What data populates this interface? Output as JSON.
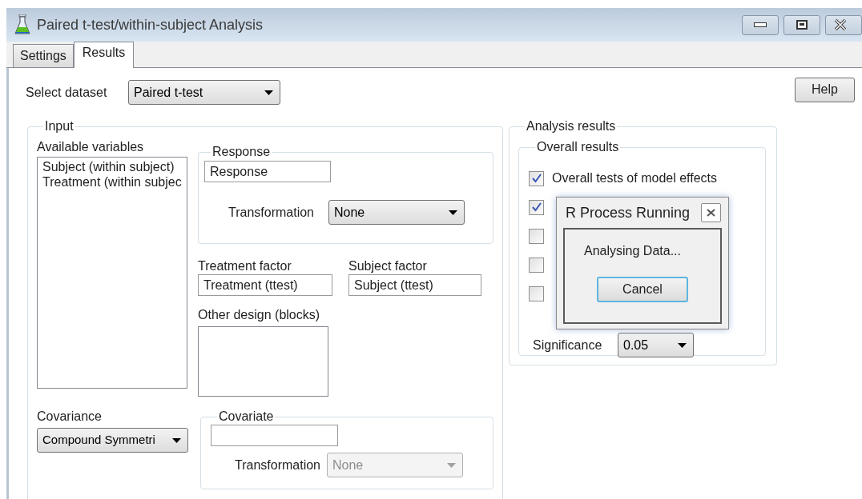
{
  "window": {
    "title": "Paired t-test/within-subject Analysis"
  },
  "tabs": [
    {
      "label": "Settings",
      "selected": false
    },
    {
      "label": "Results",
      "selected": true
    }
  ],
  "dataset": {
    "label": "Select dataset",
    "value": "Paired t-test"
  },
  "help_button": "Help",
  "input": {
    "title": "Input",
    "available_variables": {
      "label": "Available variables",
      "items": [
        "Subject (within subject)",
        "Treatment (within subjec"
      ]
    },
    "response": {
      "title": "Response",
      "value": "Response",
      "transformation": {
        "label": "Transformation",
        "value": "None",
        "disabled": false
      }
    },
    "treatment_factor": {
      "label": "Treatment factor",
      "value": "Treatment (ttest)"
    },
    "subject_factor": {
      "label": "Subject factor",
      "value": "Subject (ttest)"
    },
    "other_design": {
      "label": "Other design (blocks)"
    },
    "covariance": {
      "label": "Covariance",
      "value": "Compound Symmetri"
    },
    "covariate": {
      "title": "Covariate",
      "transformation": {
        "label": "Transformation",
        "value": "None",
        "disabled": true
      }
    }
  },
  "analysis_results": {
    "title": "Analysis results",
    "overall_results": {
      "title": "Overall results",
      "options": [
        {
          "label": "Overall tests of model effects",
          "checked": true
        },
        {
          "checked": true
        },
        {
          "checked": false
        },
        {
          "checked": false
        },
        {
          "checked": false
        }
      ],
      "significance": {
        "label": "Significance",
        "value": "0.05"
      }
    }
  },
  "progress_dialog": {
    "title": "R Process Running",
    "message": "Analysing Data...",
    "cancel_button": "Cancel"
  }
}
